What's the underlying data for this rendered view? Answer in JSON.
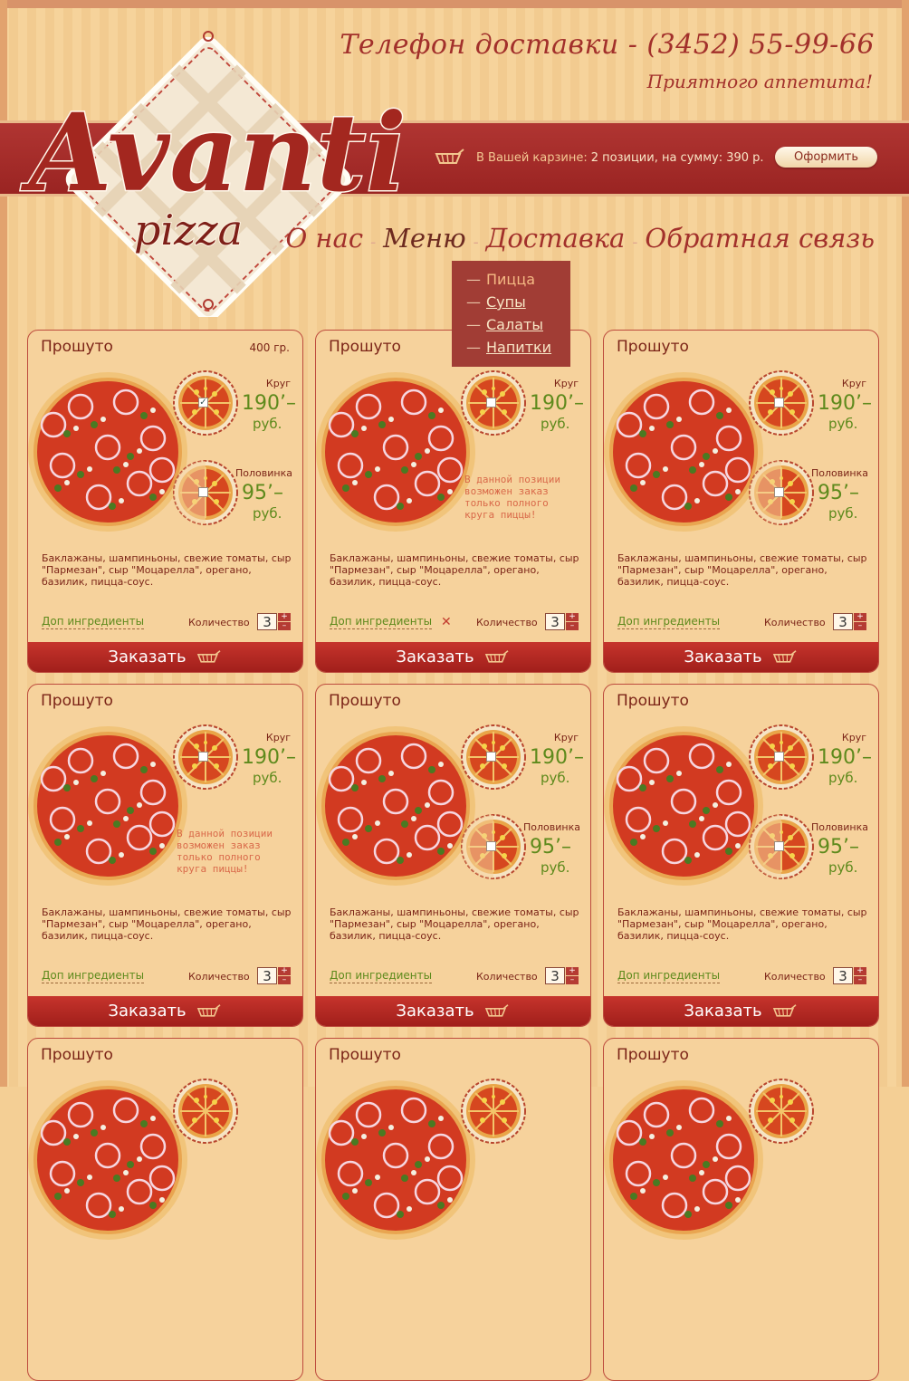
{
  "header": {
    "phone": "Телефон доставки - (3452) 55-99-66",
    "appetit": "Приятного аппетита!",
    "cart_label": "В Вашей карзине:",
    "cart_summary": "2 позиции, на сумму: 390 р.",
    "checkout_label": "Оформить",
    "logo": {
      "brand": "Avanti",
      "sub": "pizza"
    }
  },
  "nav": {
    "items": [
      "О нас",
      "Меню",
      "Доставка",
      "Обратная связь"
    ],
    "separator": "-",
    "active": "Меню"
  },
  "submenu": {
    "items": [
      {
        "label": "Пицца",
        "dash": "—"
      },
      {
        "label": "Супы",
        "dash": "—"
      },
      {
        "label": "Салаты",
        "dash": "—"
      },
      {
        "label": "Напитки",
        "dash": "—"
      }
    ],
    "selected": "Пицца"
  },
  "card_common": {
    "round_label": "Круг",
    "half_label": "Половинка",
    "price_round": "190’–",
    "price_half": "95’–",
    "currency": "руб.",
    "description": "Баклажаны, шампиньоны, свежие томаты, сыр \"Пармезан\", сыр \"Моцарелла\", орегано, базилик, пицца-соус.",
    "extras_label": "Доп ингредиенты",
    "qty_label": "Количество",
    "qty_value": "3",
    "plus": "+",
    "minus": "–",
    "order_label": "Заказать",
    "notice": "В данной позиции возможен заказ только полного круга пиццы!",
    "remove": "✕"
  },
  "cards": [
    {
      "name": "Прошуто",
      "weight": "400 гр.",
      "round_checked": true,
      "half_available": true
    },
    {
      "name": "Прошуто",
      "weight": "",
      "round_checked": false,
      "half_available": false
    },
    {
      "name": "Прошуто",
      "weight": "",
      "round_checked": false,
      "half_available": true
    },
    {
      "name": "Прошуто",
      "weight": "",
      "round_checked": false,
      "half_available": false
    },
    {
      "name": "Прошуто",
      "weight": "",
      "round_checked": false,
      "half_available": true
    },
    {
      "name": "Прошуто",
      "weight": "",
      "round_checked": false,
      "half_available": true
    },
    {
      "name": "Прошуто"
    },
    {
      "name": "Прошуто"
    },
    {
      "name": "Прошуто"
    }
  ],
  "colors": {
    "accent": "#a2302b",
    "price": "#5e8a1c",
    "background": "#f4cf95"
  }
}
